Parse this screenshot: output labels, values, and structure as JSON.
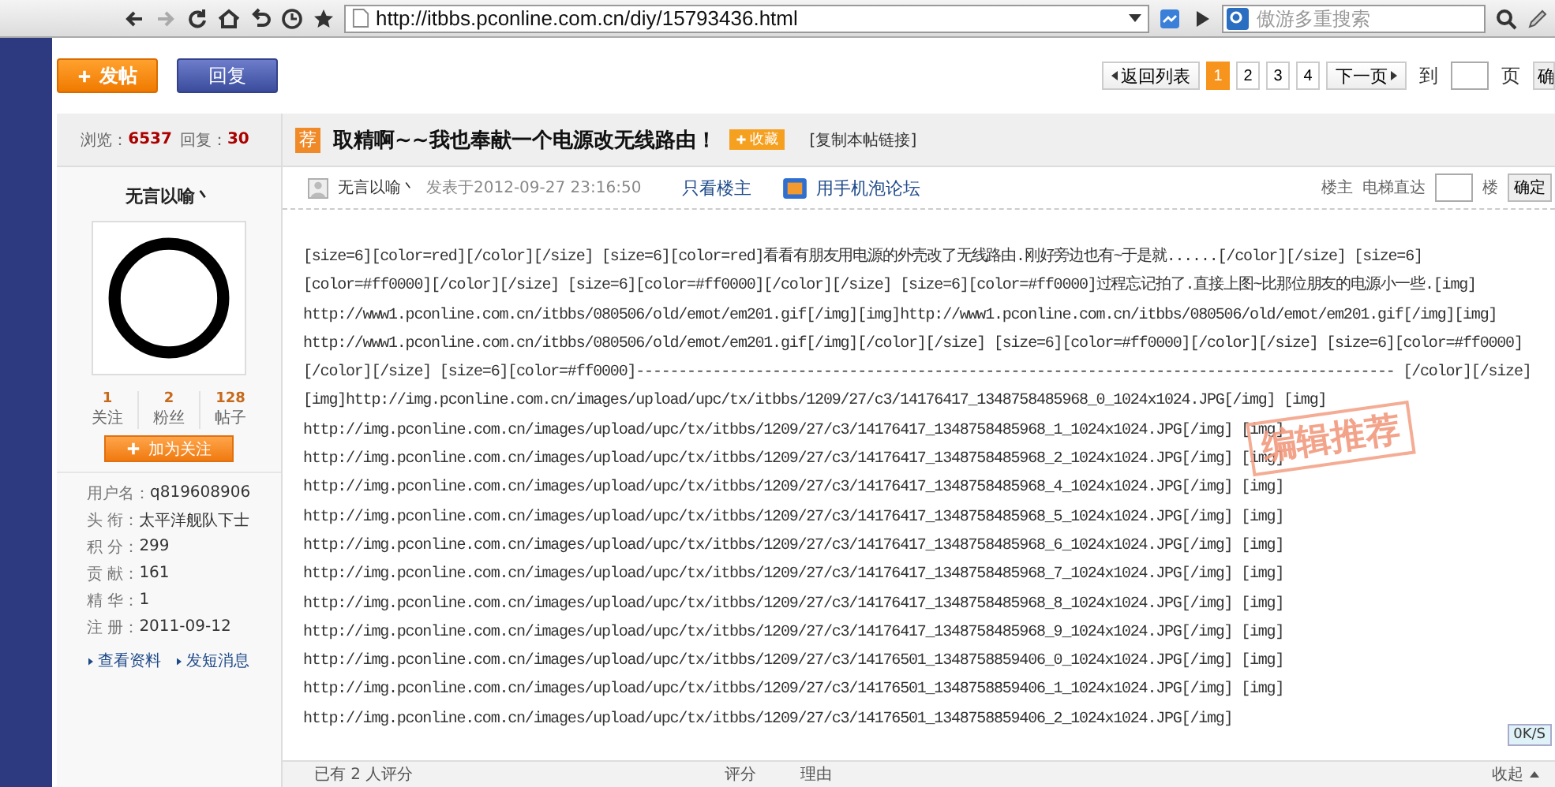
{
  "browser": {
    "url": "http://itbbs.pconline.com.cn/diy/15793436.html",
    "search_placeholder": "傲游多重搜索"
  },
  "actions": {
    "post_button": "发帖",
    "reply_button": "回复"
  },
  "pagination": {
    "back": "返回列表",
    "pages": [
      {
        "label": "1",
        "selected": true
      },
      {
        "label": "2",
        "selected": false
      },
      {
        "label": "3",
        "selected": false
      },
      {
        "label": "4",
        "selected": false
      }
    ],
    "next": "下一页",
    "goto_label": "到",
    "page_label": "页",
    "confirm": "确"
  },
  "stats": {
    "views_label": "浏览：",
    "views": "6537",
    "replies_label": "回复：",
    "replies": "30"
  },
  "thread": {
    "tag": "荐",
    "title": "取精啊~~我也奉献一个电源改无线路由！",
    "favorite": "收藏",
    "copy_link": "[复制本帖链接]"
  },
  "author": {
    "name": "无言以喻丶",
    "counts": [
      {
        "value": "1",
        "label": "关注"
      },
      {
        "value": "2",
        "label": "粉丝"
      },
      {
        "value": "128",
        "label": "帖子"
      }
    ],
    "follow_button": "加为关注",
    "info": [
      {
        "label": "用户名：",
        "value": "q819608906"
      },
      {
        "label": "头 衔：",
        "value": "太平洋舰队下士"
      },
      {
        "label": "积 分：",
        "value": "299"
      },
      {
        "label": "贡 献：",
        "value": "161"
      },
      {
        "label": "精 华：",
        "value": "1"
      },
      {
        "label": "注 册：",
        "value": "2011-09-12"
      }
    ],
    "links": [
      "查看资料",
      "发短消息"
    ]
  },
  "post": {
    "author": "无言以喻丶",
    "posted": "发表于2012-09-27 23:16:50",
    "only_op": "只看楼主",
    "mobile": "用手机泡论坛",
    "floor": "楼主",
    "jump_label": "电梯直达",
    "floor_unit": "楼",
    "confirm": "确定",
    "lines": [
      "[size=6][color=red][/color][/size] [size=6][color=red]看看有朋友用电源的外壳改了无线路由.刚好旁边也有~于是就......[/color][/size] [size=6]",
      "[color=#ff0000][/color][/size] [size=6][color=#ff0000][/color][/size] [size=6][color=#ff0000]过程忘记拍了.直接上图~比那位朋友的电源小一些.[img]",
      "http://www1.pconline.com.cn/itbbs/080506/old/emot/em201.gif[/img][img]http://www1.pconline.com.cn/itbbs/080506/old/emot/em201.gif[/img][img]",
      "http://www1.pconline.com.cn/itbbs/080506/old/emot/em201.gif[/img][/color][/size] [size=6][color=#ff0000][/color][/size] [size=6][color=#ff0000]",
      "[/color][/size] [size=6][color=#ff0000]----------------------------------------------------------------------------------------- [/color][/size]",
      "[img]http://img.pconline.com.cn/images/upload/upc/tx/itbbs/1209/27/c3/14176417_1348758485968_0_1024x1024.JPG[/img] [img]",
      "http://img.pconline.com.cn/images/upload/upc/tx/itbbs/1209/27/c3/14176417_1348758485968_1_1024x1024.JPG[/img] [img]",
      "http://img.pconline.com.cn/images/upload/upc/tx/itbbs/1209/27/c3/14176417_1348758485968_2_1024x1024.JPG[/img] [img]",
      "http://img.pconline.com.cn/images/upload/upc/tx/itbbs/1209/27/c3/14176417_1348758485968_4_1024x1024.JPG[/img] [img]",
      "http://img.pconline.com.cn/images/upload/upc/tx/itbbs/1209/27/c3/14176417_1348758485968_5_1024x1024.JPG[/img] [img]",
      "http://img.pconline.com.cn/images/upload/upc/tx/itbbs/1209/27/c3/14176417_1348758485968_6_1024x1024.JPG[/img] [img]",
      "http://img.pconline.com.cn/images/upload/upc/tx/itbbs/1209/27/c3/14176417_1348758485968_7_1024x1024.JPG[/img] [img]",
      "http://img.pconline.com.cn/images/upload/upc/tx/itbbs/1209/27/c3/14176417_1348758485968_8_1024x1024.JPG[/img] [img]",
      "http://img.pconline.com.cn/images/upload/upc/tx/itbbs/1209/27/c3/14176417_1348758485968_9_1024x1024.JPG[/img] [img]",
      "http://img.pconline.com.cn/images/upload/upc/tx/itbbs/1209/27/c3/14176501_1348758859406_0_1024x1024.JPG[/img] [img]",
      "http://img.pconline.com.cn/images/upload/upc/tx/itbbs/1209/27/c3/14176501_1348758859406_1_1024x1024.JPG[/img] [img]",
      "http://img.pconline.com.cn/images/upload/upc/tx/itbbs/1209/27/c3/14176501_1348758859406_2_1024x1024.JPG[/img]"
    ],
    "stamp": "编辑推荐"
  },
  "rating": {
    "count": "已有 2 人评分",
    "score": "评分",
    "reason": "理由",
    "collapse": "收起"
  },
  "speed": "0K/S"
}
